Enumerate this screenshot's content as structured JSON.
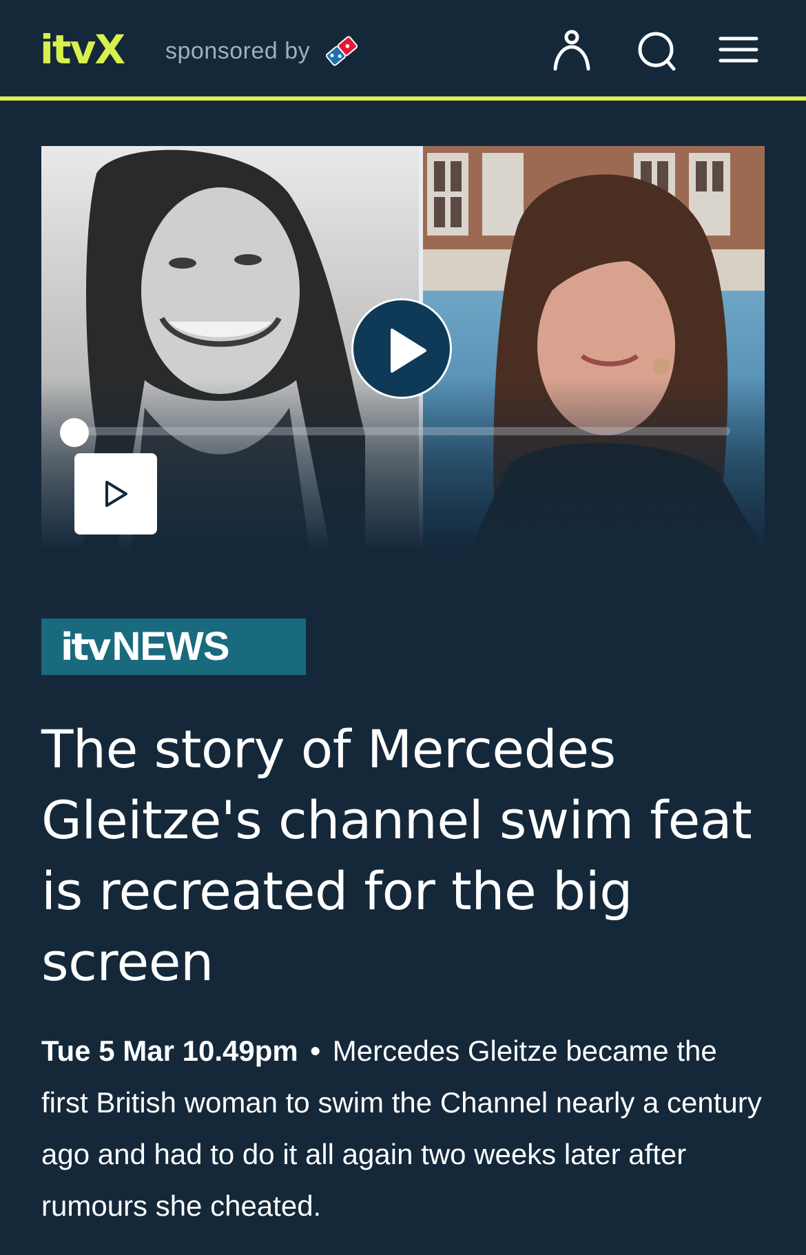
{
  "header": {
    "logo": "itvX",
    "sponsor_text": "sponsored by",
    "sponsor_logo": "dominos-logo",
    "icons": [
      "account-icon",
      "search-icon",
      "menu-icon"
    ],
    "accent_color": "#d9ef4e",
    "background_color": "#14283a"
  },
  "video": {
    "play_icon": "play-icon",
    "progress": 0.0
  },
  "article": {
    "source_brand": "itv",
    "source_label": "NEWS",
    "title": "The story of Mercedes Gleitze's channel swim feat is recreated for the big screen",
    "date": "Tue 5 Mar 10.49pm",
    "separator": "•",
    "summary": "Mercedes Gleitze became the first British woman to swim the Channel nearly a century ago and had to do it all again two weeks later after rumours she cheated.",
    "badge_color": "#1a6a7e"
  }
}
